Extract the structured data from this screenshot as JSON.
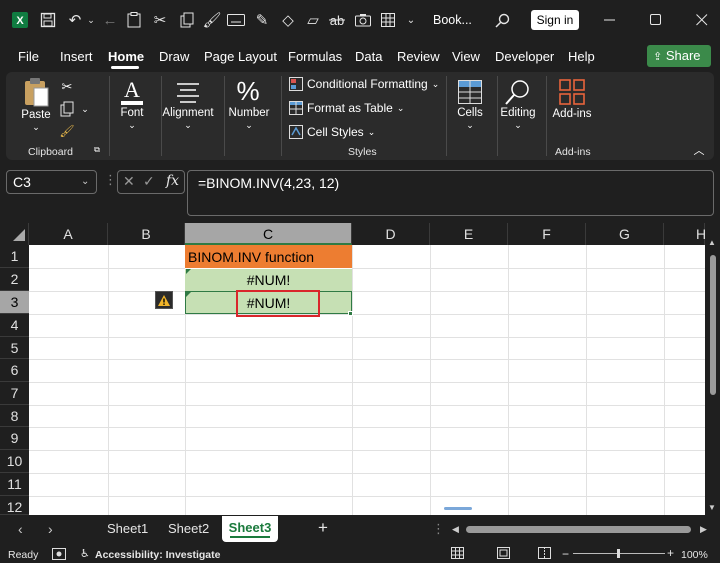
{
  "titlebar": {
    "filename": "Book...",
    "sign_in": "Sign in"
  },
  "menu": {
    "items": [
      "File",
      "Insert",
      "Home",
      "Draw",
      "Page Layout",
      "Formulas",
      "Data",
      "Review",
      "View",
      "Developer",
      "Help"
    ],
    "share": "Share"
  },
  "ribbon": {
    "paste": "Paste",
    "clipboard": "Clipboard",
    "font": "Font",
    "alignment": "Alignment",
    "number": "Number",
    "conditional_formatting": "Conditional Formatting",
    "format_as_table": "Format as Table",
    "cell_styles": "Cell Styles",
    "styles": "Styles",
    "cells": "Cells",
    "editing": "Editing",
    "add_ins": "Add-ins",
    "add_ins_group": "Add-ins"
  },
  "formula_bar": {
    "name_box": "C3",
    "fx": "fx",
    "formula": "=BINOM.INV(4,23, 12)"
  },
  "grid": {
    "columns": [
      "A",
      "B",
      "C",
      "D",
      "E",
      "F",
      "G",
      "H"
    ],
    "rows": [
      "1",
      "2",
      "3",
      "4",
      "5",
      "6",
      "7",
      "8",
      "9",
      "10",
      "11",
      "12"
    ],
    "selected_cell": "C3",
    "cells": {
      "C1": "BINOM.INV function",
      "C2": "#NUM!",
      "C3": "#NUM!"
    },
    "header_fill": "#ed7d31",
    "value_fill": "#c6e0b4",
    "highlight_border": "#d9262b"
  },
  "sheets": {
    "tabs": [
      "Sheet1",
      "Sheet2",
      "Sheet3"
    ],
    "active": "Sheet3",
    "add": "+"
  },
  "status": {
    "ready": "Ready",
    "accessibility": "Accessibility: Investigate",
    "zoom": "100%"
  },
  "colors": {
    "accent_green": "#3b8a4a",
    "sheet_tab_active": "#1a7a3c"
  }
}
